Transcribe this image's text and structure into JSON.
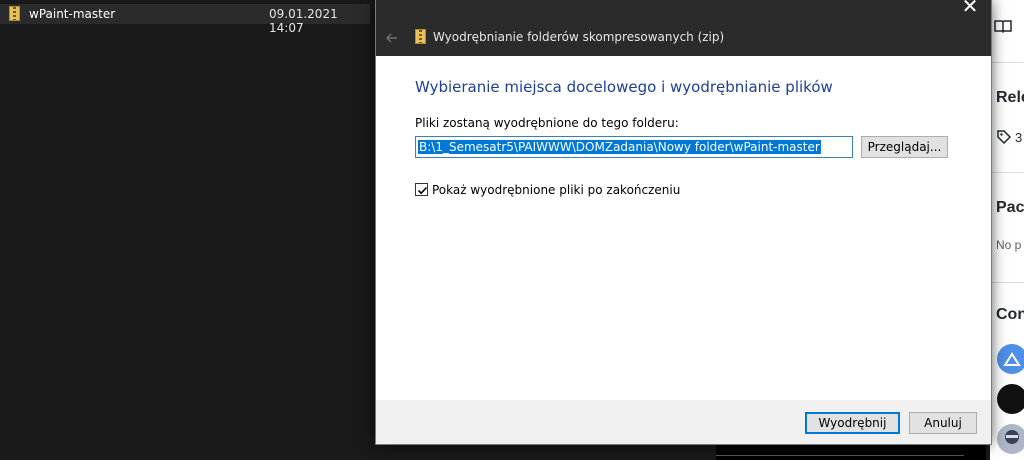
{
  "explorer": {
    "file": {
      "name": "wPaint-master",
      "date": "09.01.2021 14:07",
      "icon": "zip-folder-icon"
    }
  },
  "dialog": {
    "title": "Wyodrębnianie folderów skompresowanych (zip)",
    "heading": "Wybieranie miejsca docelowego i wyodrębnianie plików",
    "path_label": "Pliki zostaną wyodrębnione do tego folderu:",
    "path_value": "B:\\1_Semesatr5\\PAIWWW\\DOMZadania\\Nowy folder\\wPaint-master",
    "browse_label": "Przeglądaj...",
    "show_files_label": "Pokaż wyodrębnione pliki po zakończeniu",
    "show_files_checked": true,
    "extract_label": "Wyodrębnij",
    "cancel_label": "Anuluj",
    "close_symbol": "✕"
  },
  "right_panel": {
    "releases": "Rele",
    "tag_count": "3",
    "packages": "Pacl",
    "no_packages": "No p",
    "contributors": "Con"
  },
  "colors": {
    "heading": "#1e3f9a",
    "selection": "#0078d7",
    "titlebar": "#2b2b2b",
    "explorer_bg": "#191919"
  }
}
